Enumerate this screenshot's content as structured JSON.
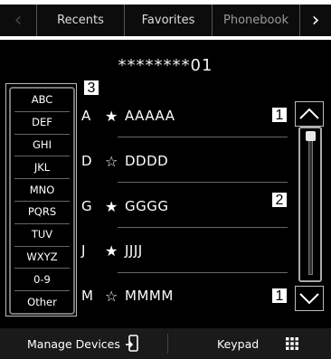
{
  "tabs": {
    "prev_icon": "chevron-left-icon",
    "next_icon": "chevron-right-icon",
    "items": [
      {
        "label": "Recents"
      },
      {
        "label": "Favorites"
      },
      {
        "label": "Phonebook",
        "active": true
      }
    ]
  },
  "phone_number": "********01",
  "index_list": [
    "ABC",
    "DEF",
    "GHI",
    "JKL",
    "MNO",
    "PQRS",
    "TUV",
    "WXYZ",
    "0-9",
    "Other"
  ],
  "contacts": [
    {
      "letter": "A",
      "star": "★",
      "name": "AAAAA"
    },
    {
      "letter": "D",
      "star": "☆",
      "name": "DDDD"
    },
    {
      "letter": "G",
      "star": "★",
      "name": "GGGG"
    },
    {
      "letter": "J",
      "star": "★",
      "name": "JJJJ"
    },
    {
      "letter": "M",
      "star": "☆",
      "name": "MMMM"
    }
  ],
  "callouts": {
    "index": "3",
    "scroll_up": "1",
    "scrollbar": "2",
    "scroll_down": "1"
  },
  "bottom": {
    "manage_devices": "Manage Devices",
    "manage_devices_icon": "phone-transfer-icon",
    "keypad": "Keypad",
    "keypad_icon": "keypad-grid-icon"
  }
}
